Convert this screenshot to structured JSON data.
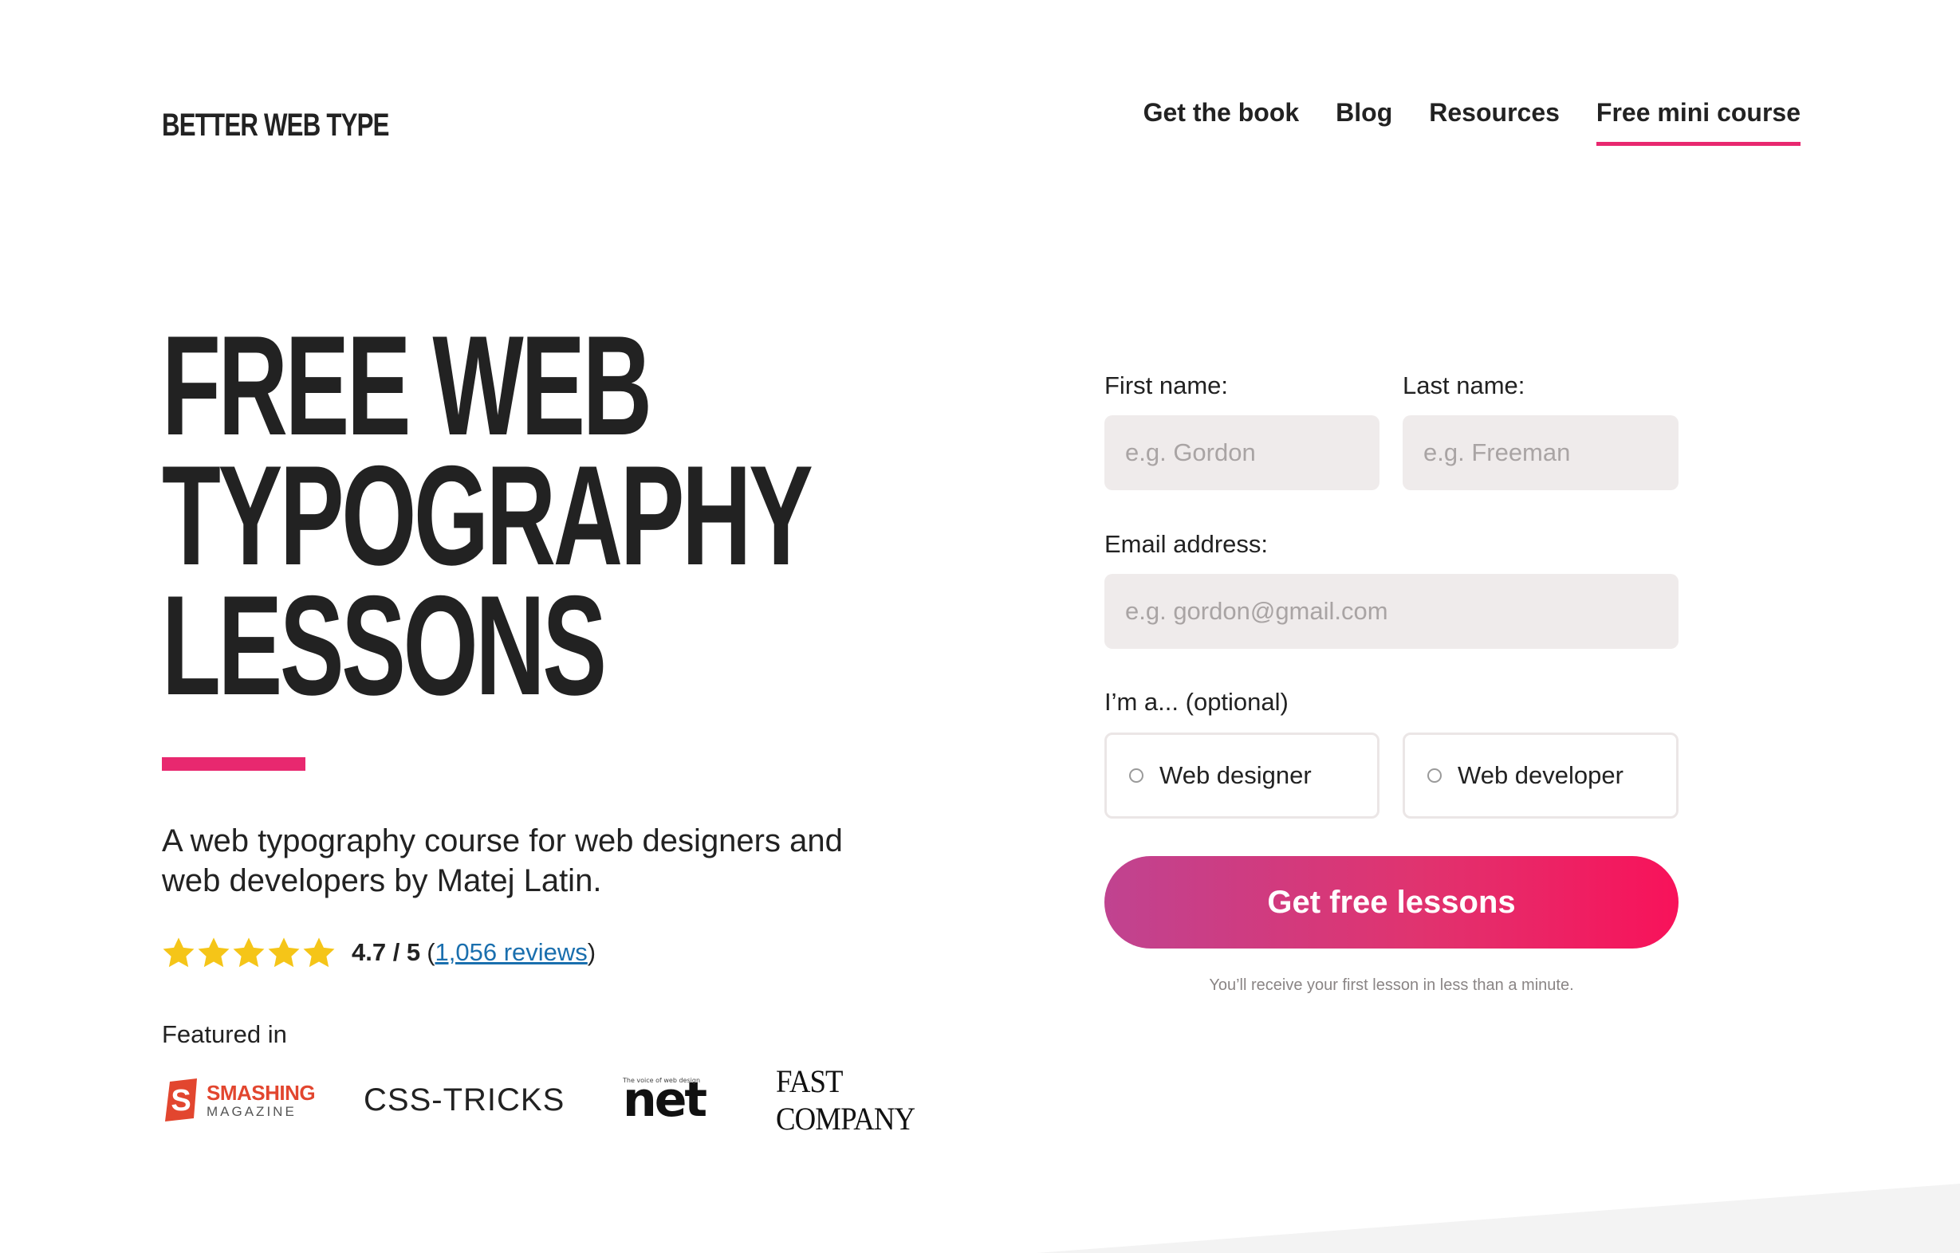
{
  "header": {
    "logo": "BETTER WEB TYPE",
    "nav": [
      {
        "label": "Get the book"
      },
      {
        "label": "Blog"
      },
      {
        "label": "Resources"
      },
      {
        "label": "Free mini course",
        "active": true
      }
    ]
  },
  "hero": {
    "title_lines": [
      "FREE WEB",
      "TYPOGRAPHY",
      "LESSONS"
    ],
    "subtitle": "A web typography course for web designers and web developers by Matej Latin.",
    "rating": {
      "stars": 5,
      "score": "4.7 / 5",
      "open_paren": "(",
      "reviews_link": "1,056 reviews",
      "close_paren": ")"
    },
    "featured_label": "Featured in",
    "featured_logos": {
      "smashing": {
        "main": "SMASHING",
        "sub": "MAGAZINE"
      },
      "csstricks": "CSS-TRICKS",
      "net": {
        "main": "net",
        "tagline": "The voice of web design"
      },
      "fastcompany": "FAST COMPANY"
    }
  },
  "form": {
    "first_name": {
      "label": "First name:",
      "placeholder": "e.g. Gordon"
    },
    "last_name": {
      "label": "Last name:",
      "placeholder": "e.g. Freeman"
    },
    "email": {
      "label": "Email address:",
      "placeholder": "e.g. gordon@gmail.com"
    },
    "role_label": "I’m a... (optional)",
    "roles": [
      {
        "label": "Web designer"
      },
      {
        "label": "Web developer"
      }
    ],
    "submit_label": "Get free lessons",
    "note": "You’ll receive your first lesson in less than a minute."
  },
  "colors": {
    "accent": "#e8286f",
    "button_start": "#c04390",
    "button_end": "#f8125a",
    "link": "#1a6fae",
    "star": "#f5c518",
    "input_bg": "#efebeb"
  }
}
